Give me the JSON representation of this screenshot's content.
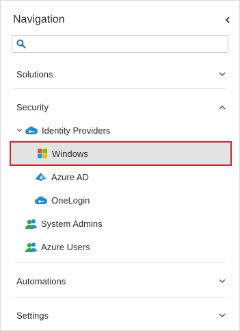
{
  "nav": {
    "title": "Navigation",
    "search": {
      "placeholder": "",
      "value": ""
    }
  },
  "sections": {
    "solutions": "Solutions",
    "security": "Security",
    "automations": "Automations",
    "settings": "Settings"
  },
  "security": {
    "identity_providers": "Identity Providers",
    "windows": "Windows",
    "azure_ad": "Azure AD",
    "onelogin": "OneLogin",
    "system_admins": "System Admins",
    "azure_users": "Azure Users"
  },
  "colors": {
    "selection_border": "#e0212a",
    "selection_bg": "#e3e3e3",
    "icon_blue": "#1c8cd6",
    "icon_green": "#2aa84a"
  },
  "icons": {
    "collapse": "chevron-left-icon",
    "search": "search-icon",
    "expand": "chevron-down-icon",
    "collapse_section": "chevron-up-icon"
  }
}
